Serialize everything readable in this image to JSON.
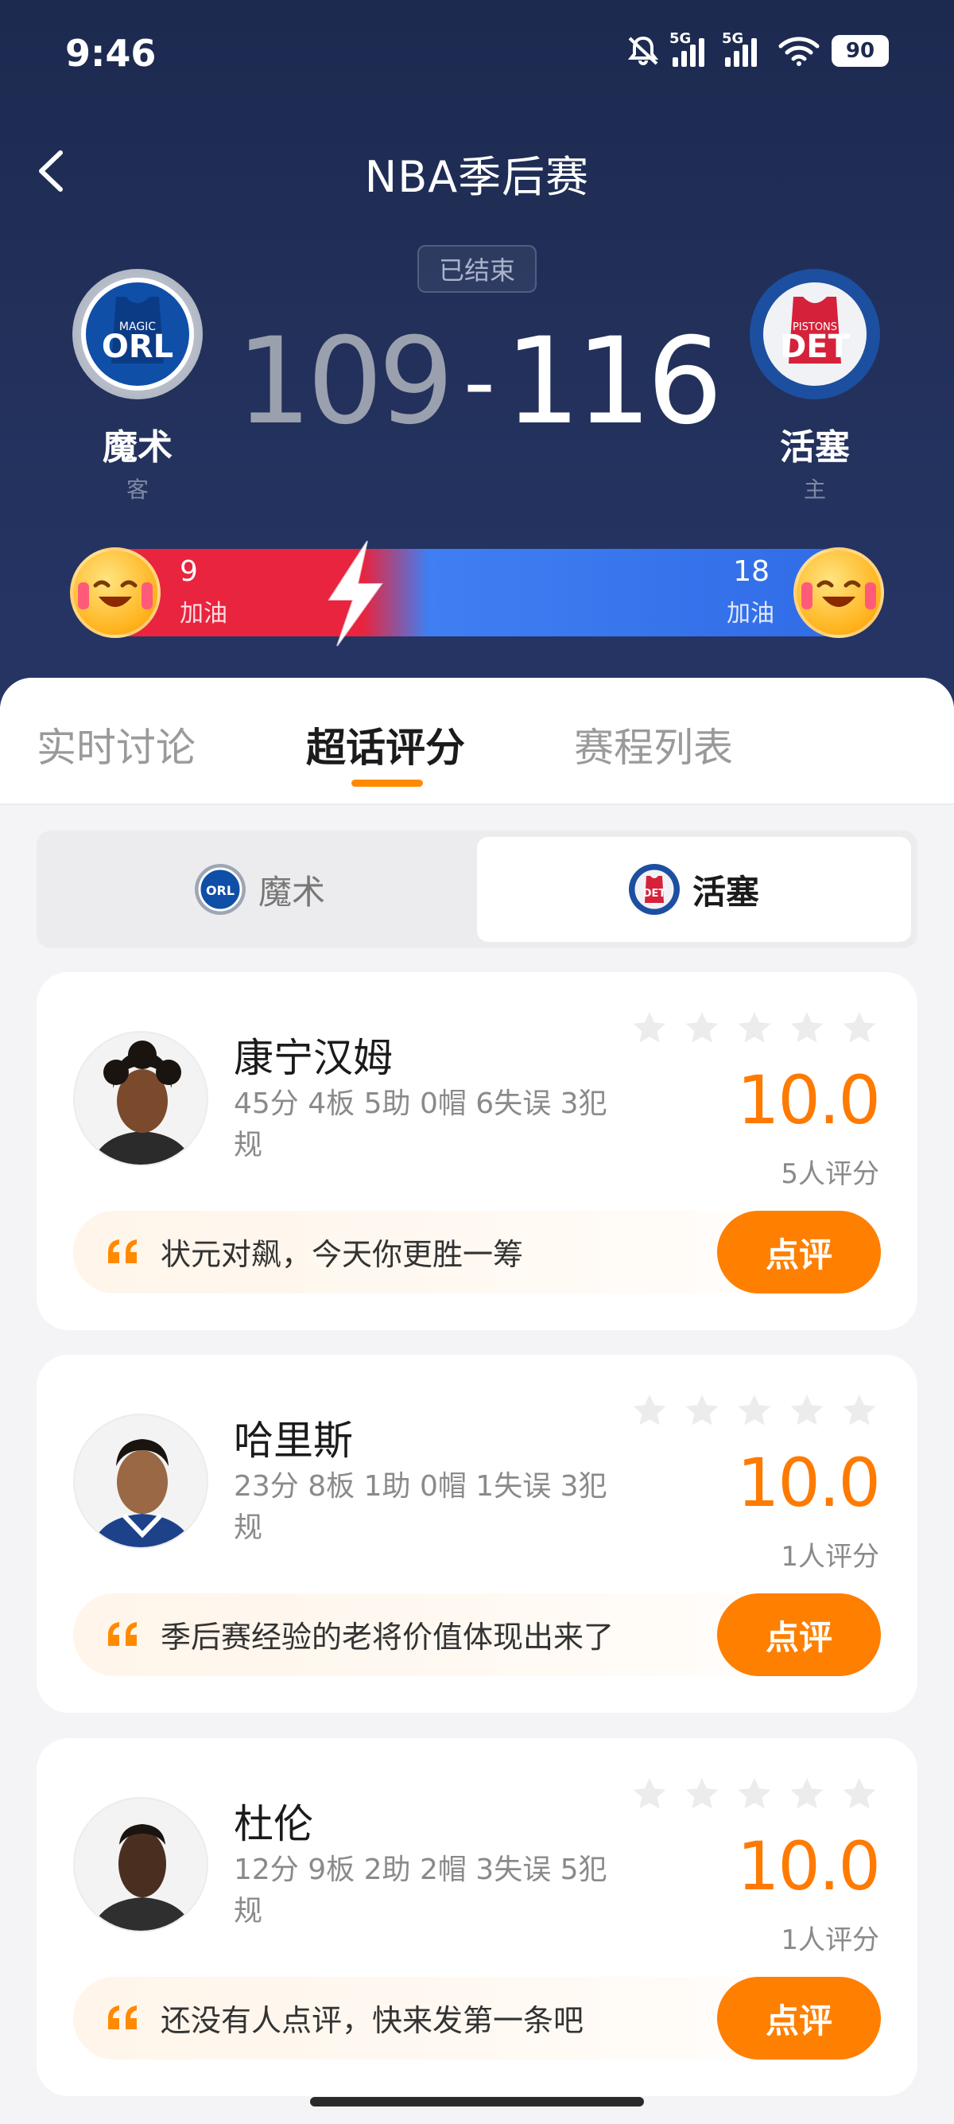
{
  "status_bar": {
    "time": "9:46",
    "signal1": "5G",
    "signal2": "5G",
    "battery": "90"
  },
  "nav": {
    "title": "NBA季后赛"
  },
  "game": {
    "status": "已结束",
    "away": {
      "name": "魔术",
      "role": "客",
      "abbr": "ORL",
      "sub": "MAGIC",
      "score": "109",
      "color": "#1d5fbf"
    },
    "home": {
      "name": "活塞",
      "role": "主",
      "abbr": "DET",
      "sub": "PISTONS",
      "score": "116",
      "color": "#d6213a"
    },
    "dash": "-"
  },
  "cheer": {
    "left": {
      "count": "9",
      "label": "加油"
    },
    "right": {
      "count": "18",
      "label": "加油"
    },
    "left_color": "#e8243e",
    "right_color": "#2f6ae6"
  },
  "tabs": [
    {
      "label": "实时讨论"
    },
    {
      "label": "超话评分"
    },
    {
      "label": "赛程列表"
    }
  ],
  "segment": {
    "left": "魔术",
    "right": "活塞"
  },
  "players": [
    {
      "name": "康宁汉姆",
      "stats": "45分 4板 5助 0帽 6失误 3犯规",
      "rating": "10.0",
      "count": "5人评分",
      "comment": "状元对飙，今天你更胜一筹",
      "button": "点评"
    },
    {
      "name": "哈里斯",
      "stats": "23分 8板 1助 0帽 1失误 3犯规",
      "rating": "10.0",
      "count": "1人评分",
      "comment": "季后赛经验的老将价值体现出来了",
      "button": "点评"
    },
    {
      "name": "杜伦",
      "stats": "12分 9板 2助 2帽 3失误 5犯规",
      "rating": "10.0",
      "count": "1人评分",
      "comment": "还没有人点评，快来发第一条吧",
      "button": "点评"
    }
  ],
  "accent_color": "#ff7f00"
}
